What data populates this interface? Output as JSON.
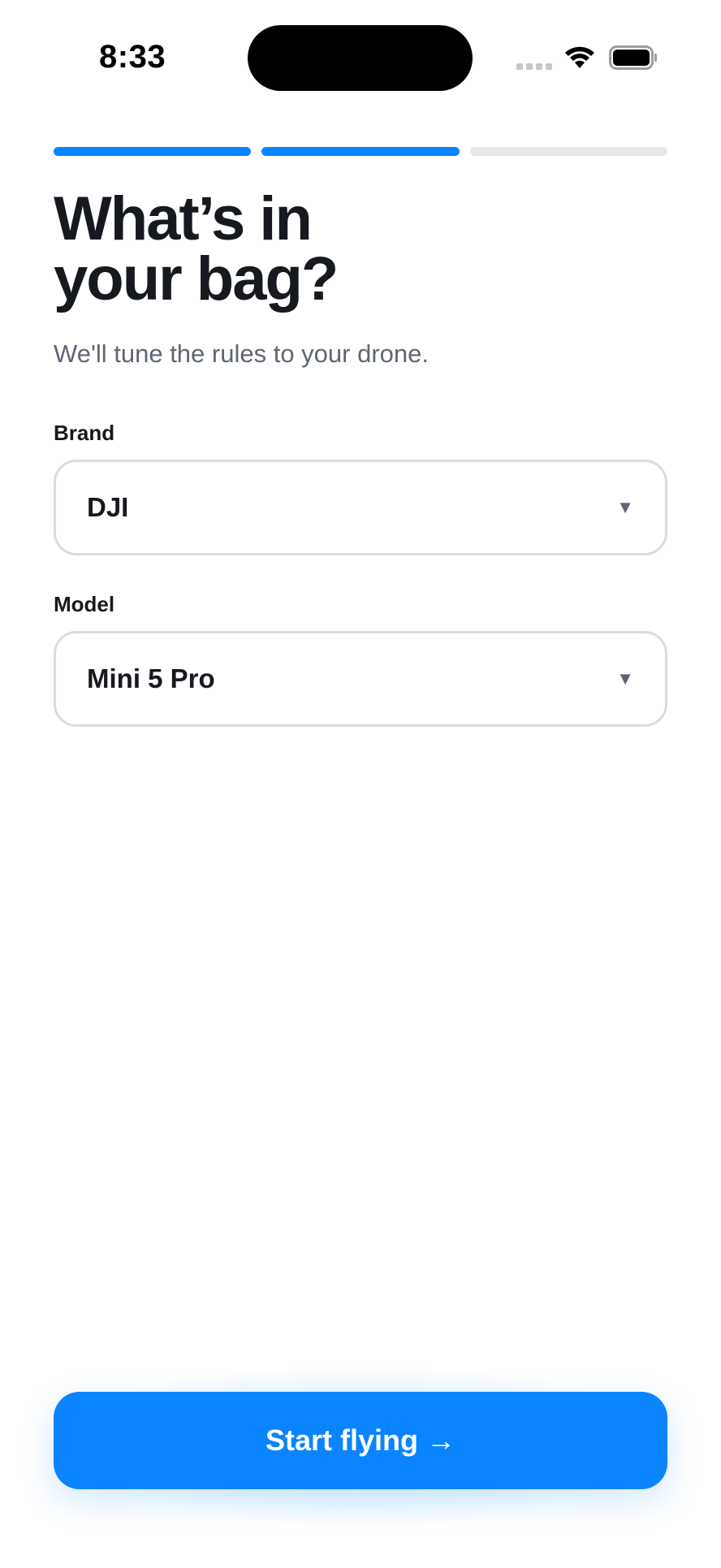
{
  "status_bar": {
    "time": "8:33",
    "icons": [
      "signal-icon",
      "wifi-icon",
      "battery-icon"
    ]
  },
  "progress": {
    "steps_total": 3,
    "steps_completed": 2,
    "active_color": "#0a84ff",
    "inactive_color": "#e6e8ec"
  },
  "header": {
    "title_line1": "What’s in",
    "title_line2": "your bag?",
    "subtitle": "We'll tune the rules to your drone."
  },
  "form": {
    "brand_label": "Brand",
    "brand_value": "DJI",
    "model_label": "Model",
    "model_value": "Mini 5 Pro",
    "caret_icon": "caret-down-icon"
  },
  "cta": {
    "label": "Start flying →",
    "color": "#0a84ff"
  }
}
